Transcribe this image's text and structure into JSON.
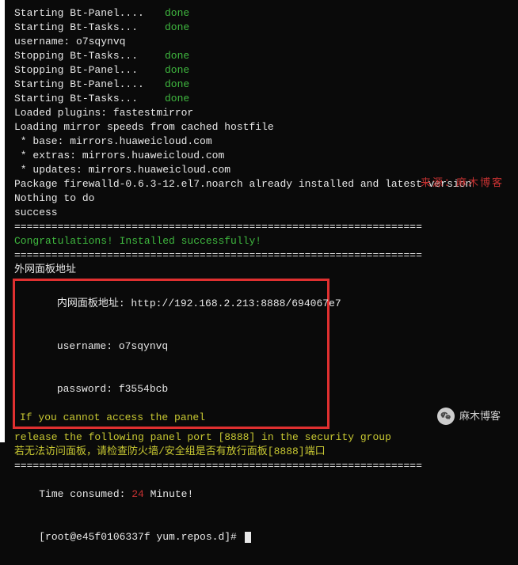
{
  "statusLines": [
    {
      "label": "Starting Bt-Panel....",
      "status": "done"
    },
    {
      "label": "Starting Bt-Tasks...",
      "status": "done"
    }
  ],
  "usernameEarly": "username: o7sqynvq",
  "statusLines2": [
    {
      "label": "Stopping Bt-Tasks...",
      "status": "done"
    },
    {
      "label": "Stopping Bt-Panel...",
      "status": "done"
    },
    {
      "label": "Starting Bt-Panel....",
      "status": "done"
    },
    {
      "label": "Starting Bt-Tasks...",
      "status": "done"
    }
  ],
  "loadedPlugins": "Loaded plugins: fastestmirror",
  "loadingMirror": "Loading mirror speeds from cached hostfile",
  "mirrors": [
    " * base: mirrors.huaweicloud.com",
    " * extras: mirrors.huaweicloud.com",
    " * updates: mirrors.huaweicloud.com"
  ],
  "packageLine": "Package firewalld-0.6.3-12.el7.noarch already installed and latest version",
  "nothingToDo": "Nothing to do",
  "success": "success",
  "divider": "==================================================================",
  "congrats": "Congratulations! Installed successfully!",
  "externalLabel": "外网面板地址",
  "panel": {
    "internalLabel": "内网面板地址: ",
    "internalUrl": "http://192.168.2.213:8888/694067e7",
    "usernameLabel": "username: ",
    "username": "o7sqynvq",
    "passwordLabel": "password: ",
    "password": "f3554bcb",
    "cutoff": "If you cannot access the panel"
  },
  "releaseLine": "release the following panel port [8888] in the security group",
  "releaseLineCN": "若无法访问面板，请检查防火墙/安全组是否有放行面板[8888]端口",
  "timeConsumedLabel": "Time consumed: ",
  "timeConsumedValue": "24",
  "timeConsumedUnit": " Minute!",
  "prompt": "[root@e45f0106337f yum.repos.d]# ",
  "watermark": {
    "source": "来源：麻木博客",
    "wechat": "麻木博客"
  }
}
